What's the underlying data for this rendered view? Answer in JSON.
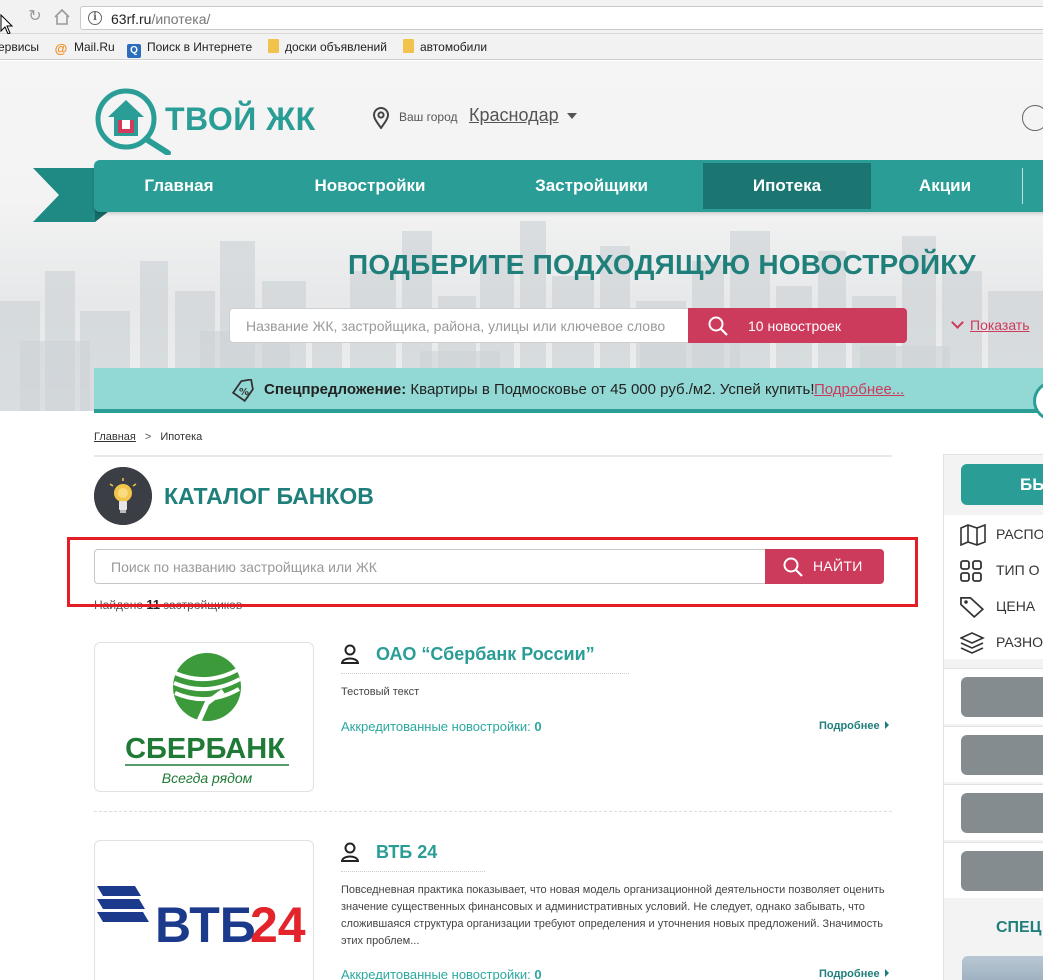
{
  "browser": {
    "url_host": "63rf.ru",
    "url_path": "/ипотека/",
    "bookmarks": [
      {
        "label": "ервисы",
        "icon": "apps-icon"
      },
      {
        "label": "Mail.Ru",
        "icon": "mailru-icon"
      },
      {
        "label": "Поиск в Интернете",
        "icon": "search-icon"
      },
      {
        "label": "доски объявлений",
        "icon": "folder-icon"
      },
      {
        "label": "автомобили",
        "icon": "folder-icon"
      }
    ]
  },
  "header": {
    "logo_text": "ТВОЙ ЖК",
    "city_label": "Ваш город",
    "city_value": "Краснодар"
  },
  "nav": {
    "items": [
      {
        "label": "Главная",
        "active": false
      },
      {
        "label": "Новостройки",
        "active": false
      },
      {
        "label": "Застройщики",
        "active": false
      },
      {
        "label": "Ипотека",
        "active": true
      },
      {
        "label": "Акции",
        "active": false
      }
    ]
  },
  "hero": {
    "title": "ПОДБЕРИТЕ ПОДХОДЯЩУЮ НОВОСТРОЙКУ",
    "search_placeholder": "Название ЖК, застройщика, района, улицы или ключевое слово",
    "button_label": "10 новостроек",
    "show_map_label": "Показать"
  },
  "promo": {
    "title": "Спецпредложение:",
    "text": " Квартиры в Подмосковье от 45 000 руб./м2. Успей купить!",
    "more": "Подробнее..."
  },
  "breadcrumb": {
    "home": "Главная",
    "separator": ">",
    "current": "Ипотека"
  },
  "catalog": {
    "title": "КАТАЛОГ БАНКОВ",
    "search_placeholder": "Поиск по названию застройщика или ЖК",
    "find_label": "НАЙТИ",
    "found_prefix": "Найдено",
    "found_count": "11",
    "found_suffix": "застройщиков"
  },
  "banks": [
    {
      "name": "ОАО “Сбербанк России”",
      "description": "Тестовый текст",
      "accredited_label": "Аккредитованные новостройки:",
      "accredited_count": "0",
      "more_label": "Подробнее",
      "logo_text": "СБЕРБАНК",
      "logo_slogan": "Всегда рядом"
    },
    {
      "name": "ВТБ 24",
      "description": "Повседневная практика показывает, что новая модель организационной деятельности позволяет оценить значение существенных финансовых и административных условий. Не следует, однако забывать, что сложившаяся структура организации требуют определения и уточнения новых предложений. Значимость этих проблем...",
      "accredited_label": "Аккредитованные новостройки:",
      "accredited_count": "0",
      "more_label": "Подробнее",
      "logo_text_blue": "ВТБ",
      "logo_text_red": "24"
    }
  ],
  "sidebar": {
    "button_label": "БЫ",
    "filters": [
      {
        "label": "РАСПО",
        "icon": "map-icon"
      },
      {
        "label": "ТИП О",
        "icon": "grid-icon"
      },
      {
        "label": "ЦЕНА",
        "icon": "price-tag-icon"
      },
      {
        "label": "РАЗНО",
        "icon": "layers-icon"
      }
    ],
    "special_label": "СПЕЦ"
  },
  "colors": {
    "brand_teal": "#2a9d96",
    "active_teal": "#1b7671",
    "accent_red": "#cc3b5c",
    "highlight_frame": "#e31e26"
  }
}
